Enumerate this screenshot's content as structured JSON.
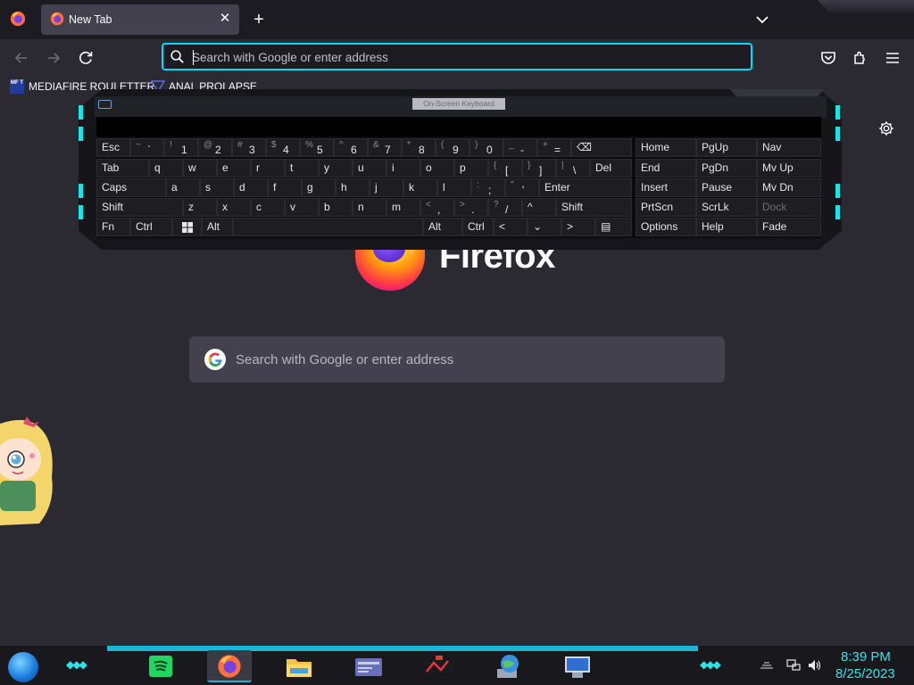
{
  "browser": {
    "tab": {
      "title": "New Tab",
      "close": "✕"
    },
    "new_tab": "+",
    "urlbar": {
      "placeholder": "Search with Google or enter address",
      "value": ""
    },
    "bookmarks": [
      {
        "icon_text": "MF T",
        "label": "MEDIAFIRE ROULETTER"
      },
      {
        "label": "ANAL PROLAPSE"
      }
    ]
  },
  "newtab_page": {
    "brand": "Firefox",
    "search": {
      "placeholder": "Search with Google or enter address"
    }
  },
  "osk": {
    "title": "On-Screen Keyboard",
    "rows": [
      [
        {
          "id": "esc",
          "label": "Esc"
        },
        {
          "id": "tilde",
          "up": "~",
          "label": "`"
        },
        {
          "id": "1",
          "up": "!",
          "label": "1"
        },
        {
          "id": "2",
          "up": "@",
          "label": "2"
        },
        {
          "id": "3",
          "up": "#",
          "label": "3"
        },
        {
          "id": "4",
          "up": "$",
          "label": "4"
        },
        {
          "id": "5",
          "up": "%",
          "label": "5"
        },
        {
          "id": "6",
          "up": "^",
          "label": "6"
        },
        {
          "id": "7",
          "up": "&",
          "label": "7"
        },
        {
          "id": "8",
          "up": "*",
          "label": "8"
        },
        {
          "id": "9",
          "up": "(",
          "label": "9"
        },
        {
          "id": "0",
          "up": ")",
          "label": "0"
        },
        {
          "id": "minus",
          "up": "_",
          "label": "-"
        },
        {
          "id": "equals",
          "up": "+",
          "label": "="
        },
        {
          "id": "backspace",
          "label": "⌫"
        }
      ],
      [
        {
          "id": "tab",
          "label": "Tab"
        },
        {
          "id": "q",
          "label": "q"
        },
        {
          "id": "w",
          "label": "w"
        },
        {
          "id": "e",
          "label": "e"
        },
        {
          "id": "r",
          "label": "r"
        },
        {
          "id": "t",
          "label": "t"
        },
        {
          "id": "y",
          "label": "y"
        },
        {
          "id": "u",
          "label": "u"
        },
        {
          "id": "i",
          "label": "i"
        },
        {
          "id": "o",
          "label": "o"
        },
        {
          "id": "p",
          "label": "p"
        },
        {
          "id": "lbracket",
          "up": "{",
          "label": "["
        },
        {
          "id": "rbracket",
          "up": "}",
          "label": "]"
        },
        {
          "id": "backslash",
          "up": "|",
          "label": "\\"
        },
        {
          "id": "del",
          "label": "Del"
        }
      ],
      [
        {
          "id": "caps",
          "label": "Caps"
        },
        {
          "id": "a",
          "label": "a"
        },
        {
          "id": "s",
          "label": "s"
        },
        {
          "id": "d",
          "label": "d"
        },
        {
          "id": "f",
          "label": "f"
        },
        {
          "id": "g",
          "label": "g"
        },
        {
          "id": "h",
          "label": "h"
        },
        {
          "id": "j",
          "label": "j"
        },
        {
          "id": "k",
          "label": "k"
        },
        {
          "id": "l",
          "label": "l"
        },
        {
          "id": "semicolon",
          "up": ":",
          "label": ";"
        },
        {
          "id": "quote",
          "up": "\"",
          "label": "'"
        },
        {
          "id": "enter",
          "label": "Enter"
        }
      ],
      [
        {
          "id": "lshift",
          "label": "Shift"
        },
        {
          "id": "z",
          "label": "z"
        },
        {
          "id": "x",
          "label": "x"
        },
        {
          "id": "c",
          "label": "c"
        },
        {
          "id": "v",
          "label": "v"
        },
        {
          "id": "b",
          "label": "b"
        },
        {
          "id": "n",
          "label": "n"
        },
        {
          "id": "m",
          "label": "m"
        },
        {
          "id": "comma",
          "up": "<",
          "label": ","
        },
        {
          "id": "period",
          "up": ">",
          "label": "."
        },
        {
          "id": "slash",
          "up": "?",
          "label": "/"
        },
        {
          "id": "up",
          "label": "^"
        },
        {
          "id": "rshift",
          "label": "Shift"
        }
      ],
      [
        {
          "id": "fn",
          "label": "Fn"
        },
        {
          "id": "lctrl",
          "label": "Ctrl"
        },
        {
          "id": "win",
          "label": ""
        },
        {
          "id": "lalt",
          "label": "Alt"
        },
        {
          "id": "space",
          "label": ""
        },
        {
          "id": "ralt",
          "label": "Alt"
        },
        {
          "id": "rctrl",
          "label": "Ctrl"
        },
        {
          "id": "left",
          "label": "<"
        },
        {
          "id": "down",
          "label": "⌄"
        },
        {
          "id": "right",
          "label": ">"
        },
        {
          "id": "menu",
          "label": "▤"
        }
      ]
    ],
    "nav_keys": [
      [
        "Home",
        "PgUp",
        "Nav"
      ],
      [
        "End",
        "PgDn",
        "Mv Up"
      ],
      [
        "Insert",
        "Pause",
        "Mv Dn"
      ],
      [
        "PrtScn",
        "ScrLk",
        "Dock"
      ],
      [
        "Options",
        "Help",
        "Fade"
      ]
    ]
  },
  "taskbar": {
    "items": [
      "spotify",
      "firefox",
      "file-explorer",
      "id-card",
      "game",
      "network-globe",
      "remote-desktop"
    ],
    "active": "firefox",
    "clock": {
      "time": "8:39 PM",
      "date": "8/25/2023"
    }
  },
  "colors": {
    "accent": "#00ddff",
    "taskbar_accent": "#1bb6d6",
    "clock": "#3fe0e8"
  }
}
